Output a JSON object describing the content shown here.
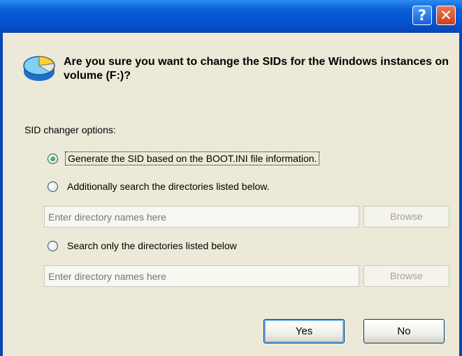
{
  "titlebar": {
    "help_glyph": "?",
    "close_glyph": "✕"
  },
  "dialog": {
    "question": "Are you sure you want to change the SIDs for the Windows instances on volume (F:)?",
    "options_label": "SID changer options:",
    "options": [
      {
        "label": "Generate the SID based on the BOOT.INI file information.",
        "selected": true
      },
      {
        "label": "Additionally search the directories listed below.",
        "selected": false
      },
      {
        "label": "Search only the directories listed below",
        "selected": false
      }
    ],
    "dir_inputs": [
      {
        "placeholder": "Enter directory names here",
        "browse_label": "Browse"
      },
      {
        "placeholder": "Enter directory names here",
        "browse_label": "Browse"
      }
    ],
    "buttons": {
      "yes": "Yes",
      "no": "No"
    }
  },
  "colors": {
    "titlebar": "#0553d0",
    "body": "#ece9d8",
    "close": "#c8401f"
  },
  "icons": {
    "dialog_icon": "disk-pie-icon",
    "help": "help-icon",
    "close": "close-icon"
  }
}
